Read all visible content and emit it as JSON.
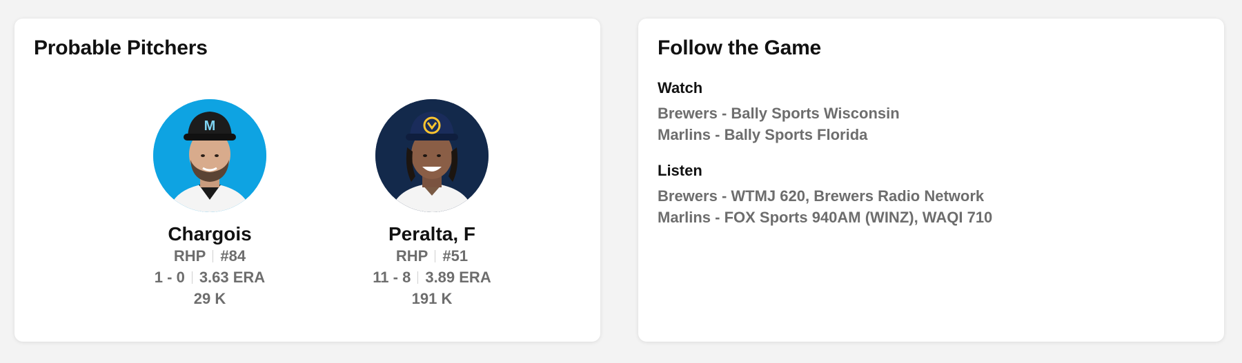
{
  "probable_pitchers": {
    "title": "Probable Pitchers",
    "pitchers": [
      {
        "name": "Chargois",
        "throws": "RHP",
        "number": "#84",
        "record": "1 - 0",
        "era": "3.63 ERA",
        "strikeouts": "29 K",
        "headshot_bg": "#0ea3e2",
        "team": "Marlins"
      },
      {
        "name": "Peralta, F",
        "throws": "RHP",
        "number": "#51",
        "record": "11 - 8",
        "era": "3.89 ERA",
        "strikeouts": "191 K",
        "headshot_bg": "#13294b",
        "team": "Brewers"
      }
    ]
  },
  "follow_game": {
    "title": "Follow the Game",
    "watch": {
      "label": "Watch",
      "lines": [
        "Brewers - Bally Sports Wisconsin",
        "Marlins - Bally Sports Florida"
      ]
    },
    "listen": {
      "label": "Listen",
      "lines": [
        "Brewers - WTMJ 620, Brewers Radio Network",
        "Marlins - FOX Sports 940AM (WINZ), WAQI 710"
      ]
    }
  }
}
